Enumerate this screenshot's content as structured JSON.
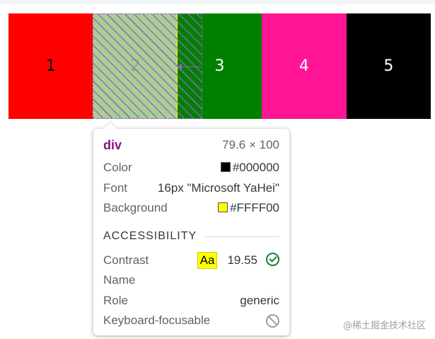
{
  "boxes": [
    {
      "label": "1",
      "bg": "#ff0000",
      "fg": "#000000"
    },
    {
      "label": "2",
      "bg": "#ffff00",
      "fg": "#000000"
    },
    {
      "label": "3",
      "bg": "#008000",
      "fg": "#ffffff"
    },
    {
      "label": "4",
      "bg": "#ff1493",
      "fg": "#ffffff"
    },
    {
      "label": "5",
      "bg": "#000000",
      "fg": "#ffffff"
    }
  ],
  "tooltip": {
    "tag": "div",
    "dimensions": "79.6 × 100",
    "color_label": "Color",
    "color_value": "#000000",
    "font_label": "Font",
    "font_value": "16px \"Microsoft YaHei\"",
    "background_label": "Background",
    "background_value": "#FFFF00",
    "accessibility_title": "ACCESSIBILITY",
    "contrast_label": "Contrast",
    "contrast_sample": "Aa",
    "contrast_value": "19.55",
    "name_label": "Name",
    "role_label": "Role",
    "role_value": "generic",
    "focusable_label": "Keyboard-focusable"
  },
  "watermark": "@稀土掘金技术社区"
}
